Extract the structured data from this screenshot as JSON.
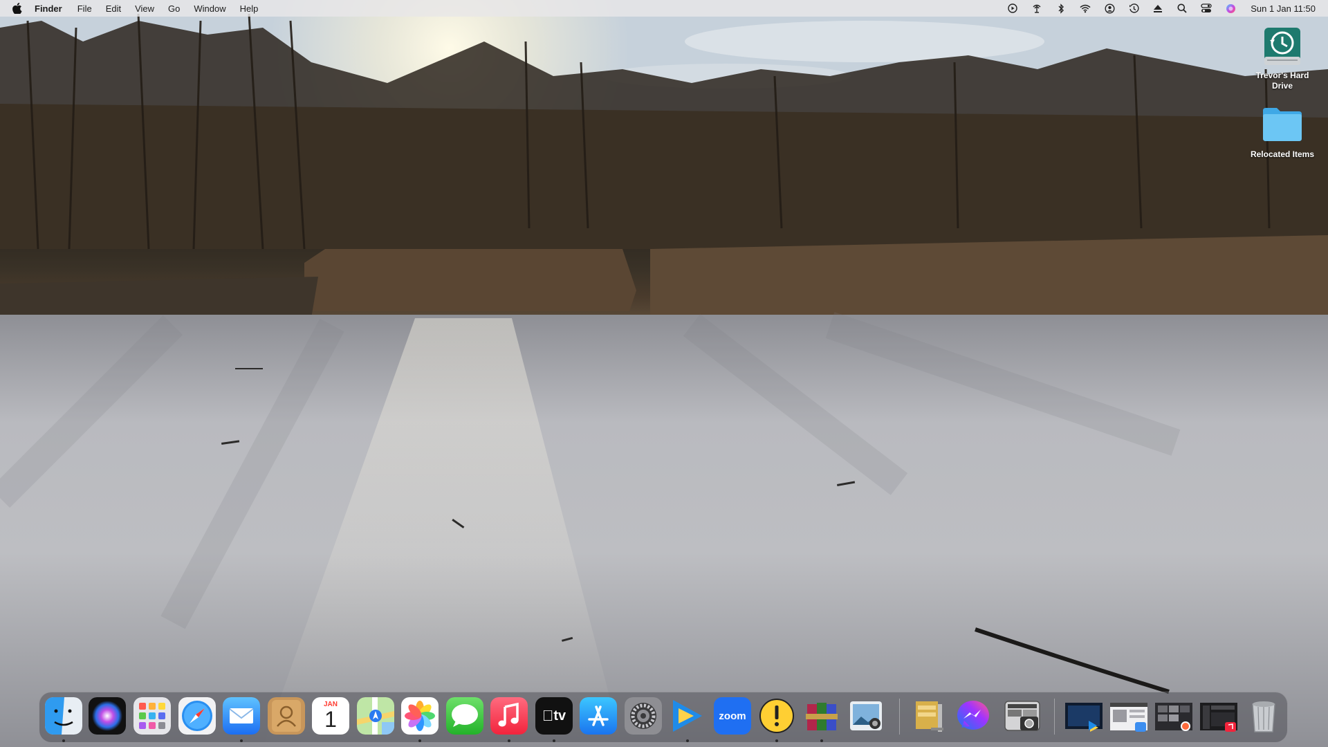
{
  "menubar": {
    "app_name": "Finder",
    "items": [
      "File",
      "Edit",
      "View",
      "Go",
      "Window",
      "Help"
    ],
    "status_icons": [
      "play-circle-icon",
      "airplay-icon",
      "bluetooth-icon",
      "wifi-icon",
      "user-account-icon",
      "time-machine-icon",
      "eject-icon",
      "spotlight-search-icon",
      "control-center-icon",
      "siri-icon"
    ],
    "clock": "Sun 1 Jan  11:50"
  },
  "desktop": {
    "icons": [
      {
        "label": "Trevor's Hard Drive",
        "icon": "time-machine-drive-icon"
      },
      {
        "label": "Relocated Items",
        "icon": "folder-icon"
      }
    ]
  },
  "dock": {
    "apps": [
      {
        "name": "Finder",
        "running": true
      },
      {
        "name": "Siri",
        "running": false
      },
      {
        "name": "Launchpad",
        "running": false
      },
      {
        "name": "Safari",
        "running": false
      },
      {
        "name": "Mail",
        "running": true
      },
      {
        "name": "Contacts",
        "running": false
      },
      {
        "name": "Calendar",
        "running": false,
        "month": "JAN",
        "day": "1"
      },
      {
        "name": "Maps",
        "running": false
      },
      {
        "name": "Photos",
        "running": true
      },
      {
        "name": "Messages",
        "running": false
      },
      {
        "name": "Music",
        "running": true
      },
      {
        "name": "TV",
        "running": true,
        "label": "tv"
      },
      {
        "name": "App Store",
        "running": false
      },
      {
        "name": "System Settings",
        "running": false
      },
      {
        "name": "Infuse",
        "running": true
      },
      {
        "name": "Zoom",
        "running": false,
        "label": "zoom"
      },
      {
        "name": "Console",
        "running": true
      },
      {
        "name": "WinRAR",
        "running": true
      },
      {
        "name": "Preview",
        "running": false
      },
      {
        "name": "Archive Utility",
        "running": false
      },
      {
        "name": "Messenger",
        "running": false
      },
      {
        "name": "Screenshot",
        "running": false
      }
    ],
    "minimized": [
      {
        "name": "minimized-window-1"
      },
      {
        "name": "minimized-window-2"
      },
      {
        "name": "minimized-window-3"
      },
      {
        "name": "minimized-window-4"
      }
    ],
    "trash": {
      "name": "Trash"
    }
  }
}
